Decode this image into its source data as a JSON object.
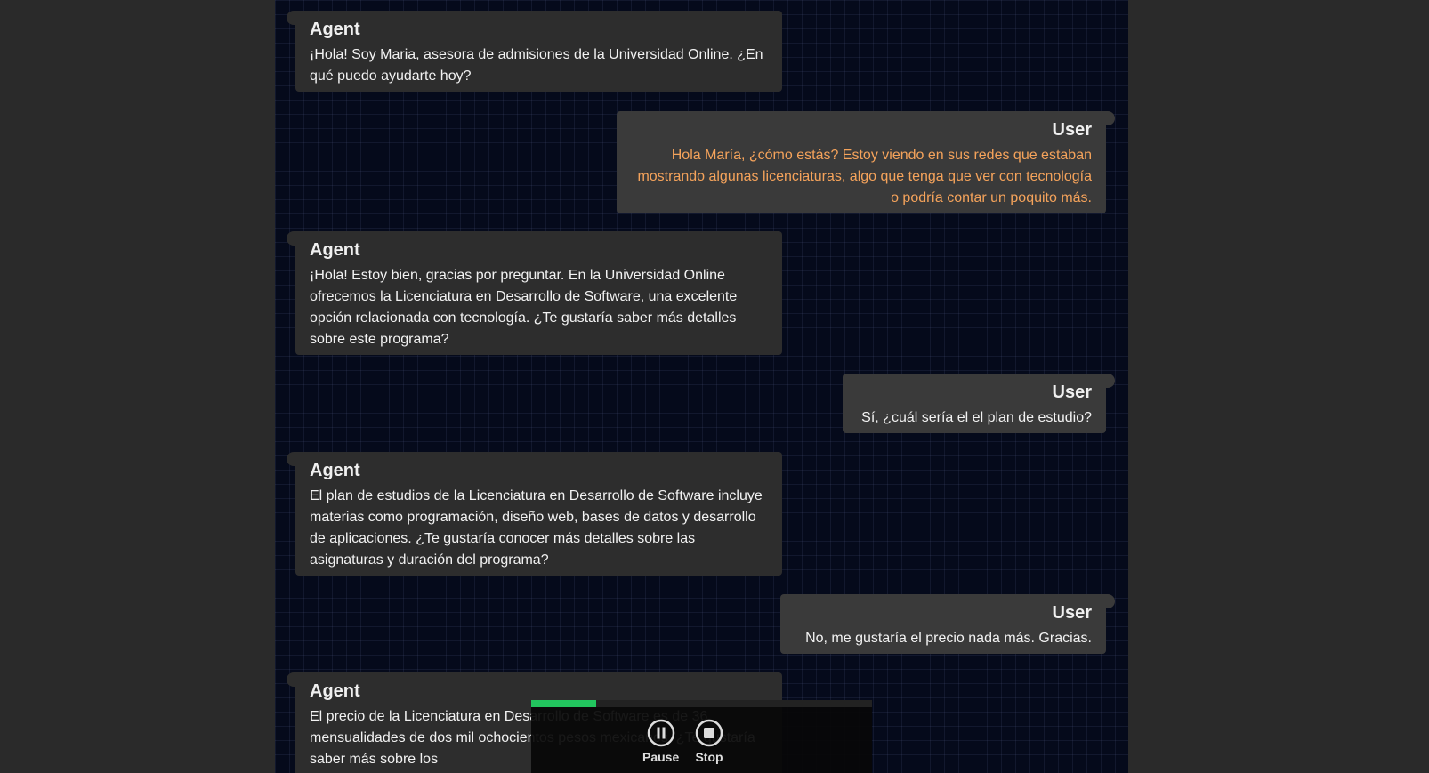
{
  "messages": [
    {
      "role": "Agent",
      "text": "¡Hola! Soy Maria, asesora de admisiones de la Universidad Online. ¿En qué puedo ayudarte hoy?"
    },
    {
      "role": "User",
      "text": "Hola María, ¿cómo estás? Estoy viendo en sus redes que estaban mostrando algunas licenciaturas, algo que tenga que ver con tecnología o podría contar un poquito más."
    },
    {
      "role": "Agent",
      "text": "¡Hola! Estoy bien, gracias por preguntar. En la Universidad Online ofrecemos la Licenciatura en Desarrollo de Software, una excelente opción relacionada con tecnología. ¿Te gustaría saber más detalles sobre este programa?"
    },
    {
      "role": "User",
      "text": "Sí, ¿cuál sería el el plan de estudio?"
    },
    {
      "role": "Agent",
      "text": "El plan de estudios de la Licenciatura en Desarrollo de Software incluye materias como programación, diseño web, bases de datos y desarrollo de aplicaciones. ¿Te gustaría conocer más detalles sobre las asignaturas y duración del programa?"
    },
    {
      "role": "User",
      "text": "No, me gustaría el precio nada más. Gracias."
    },
    {
      "role": "Agent",
      "text": "El precio de la Licenciatura en Desarrollo de Software es de 36 mensualidades de dos mil ochocientos pesos mexicanos. ¿Te gustaría saber más sobre los"
    }
  ],
  "player": {
    "progress_percent": 19,
    "pause_label": "Pause",
    "stop_label": "Stop",
    "accent": "#22c55e"
  },
  "colors": {
    "user_highlight": "#f5a35b"
  }
}
